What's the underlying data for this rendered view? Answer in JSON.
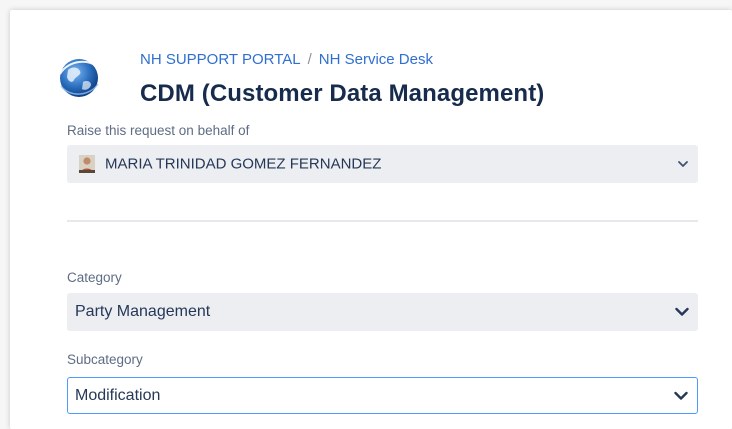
{
  "header": {
    "breadcrumb": [
      "NH SUPPORT PORTAL",
      "NH Service Desk"
    ],
    "separator": "/",
    "title": "CDM (Customer Data Management)"
  },
  "behalf": {
    "label": "Raise this request on behalf of",
    "value": "MARIA TRINIDAD GOMEZ FERNANDEZ",
    "icon": "avatar-icon"
  },
  "category": {
    "label": "Category",
    "value": "Party Management"
  },
  "subcategory": {
    "label": "Subcategory",
    "value": "Modification"
  },
  "colors": {
    "link": "#2f6fd0",
    "title": "#172b4d",
    "field_bg": "#eceef1",
    "focus_border": "#4c9aff"
  }
}
